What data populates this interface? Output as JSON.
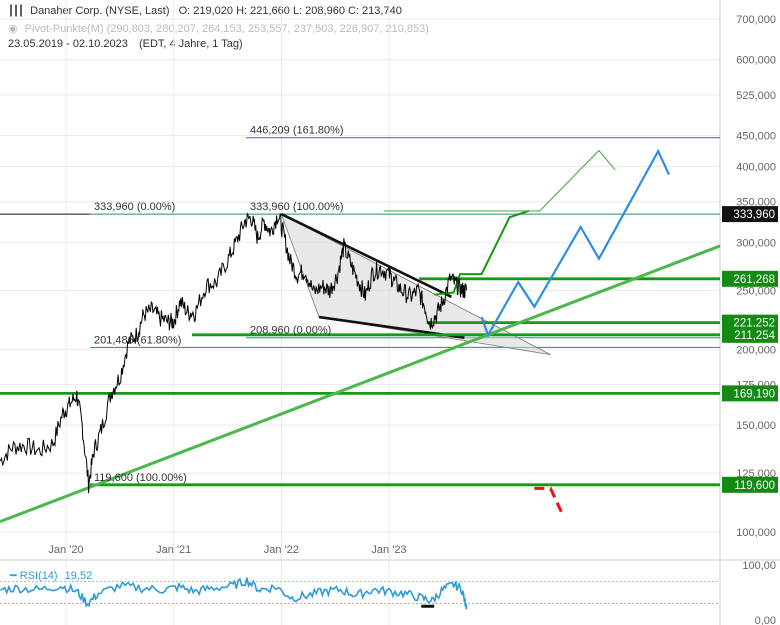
{
  "header": {
    "title": "Danaher Corp. (NYSE, Last)",
    "ohlc": "O: 219,020  H: 221,660  L: 208,960  C: 213,740",
    "pivot": "Pivot-Punkte(M)  (290,803,  280,207,  264,153,  253,557,  237,503,  226,907,  210,853)",
    "range": "23.05.2019 - 02.10.2023",
    "interval": "(EDT, 4 Jahre, 1 Tag)"
  },
  "rsi": {
    "label": "RSI(14)",
    "value": "19,52",
    "axis": [
      "100,00",
      "0,00"
    ]
  },
  "chart_data": {
    "type": "line",
    "title": "Danaher Corp. (NYSE, Last)",
    "yscale": "log",
    "ylim": [
      92,
      730
    ],
    "y_ticks": [
      {
        "v": 700,
        "label": "700,000"
      },
      {
        "v": 600,
        "label": "600,000"
      },
      {
        "v": 525,
        "label": "525,000"
      },
      {
        "v": 450,
        "label": "450,000"
      },
      {
        "v": 400,
        "label": "400,000"
      },
      {
        "v": 350,
        "label": "350,000"
      },
      {
        "v": 300,
        "label": "300,000"
      },
      {
        "v": 250,
        "label": "250,000"
      },
      {
        "v": 200,
        "label": "200,000"
      },
      {
        "v": 175,
        "label": "175,000"
      },
      {
        "v": 150,
        "label": "150,000"
      },
      {
        "v": 125,
        "label": "125,000"
      },
      {
        "v": 100,
        "label": "100,000"
      }
    ],
    "x_ticks": [
      {
        "t": 2020.0,
        "label": "Jan '20"
      },
      {
        "t": 2021.0,
        "label": "Jan '21"
      },
      {
        "t": 2022.0,
        "label": "Jan '22"
      },
      {
        "t": 2023.0,
        "label": "Jan '23"
      }
    ],
    "xlim": [
      2019.39,
      2024.8
    ],
    "series": [
      {
        "name": "Danaher Corp.",
        "points": [
          [
            2019.39,
            131
          ],
          [
            2019.5,
            138
          ],
          [
            2019.62,
            139
          ],
          [
            2019.75,
            136
          ],
          [
            2019.88,
            140
          ],
          [
            2019.97,
            157
          ],
          [
            2020.03,
            162
          ],
          [
            2020.1,
            168
          ],
          [
            2020.15,
            150
          ],
          [
            2020.21,
            120
          ],
          [
            2020.26,
            136
          ],
          [
            2020.33,
            148
          ],
          [
            2020.42,
            170
          ],
          [
            2020.5,
            180
          ],
          [
            2020.58,
            205
          ],
          [
            2020.66,
            212
          ],
          [
            2020.72,
            228
          ],
          [
            2020.8,
            232
          ],
          [
            2020.87,
            225
          ],
          [
            2020.95,
            222
          ],
          [
            2021.0,
            222
          ],
          [
            2021.06,
            240
          ],
          [
            2021.13,
            230
          ],
          [
            2021.2,
            230
          ],
          [
            2021.3,
            255
          ],
          [
            2021.4,
            258
          ],
          [
            2021.5,
            280
          ],
          [
            2021.58,
            300
          ],
          [
            2021.66,
            325
          ],
          [
            2021.72,
            330
          ],
          [
            2021.78,
            305
          ],
          [
            2021.84,
            325
          ],
          [
            2021.9,
            312
          ],
          [
            2021.97,
            334
          ],
          [
            2022.02,
            310
          ],
          [
            2022.08,
            280
          ],
          [
            2022.15,
            265
          ],
          [
            2022.22,
            270
          ],
          [
            2022.3,
            248
          ],
          [
            2022.38,
            254
          ],
          [
            2022.45,
            250
          ],
          [
            2022.52,
            265
          ],
          [
            2022.58,
            295
          ],
          [
            2022.65,
            275
          ],
          [
            2022.72,
            258
          ],
          [
            2022.78,
            245
          ],
          [
            2022.85,
            268
          ],
          [
            2022.92,
            272
          ],
          [
            2023.0,
            266
          ],
          [
            2023.05,
            258
          ],
          [
            2023.12,
            250
          ],
          [
            2023.2,
            244
          ],
          [
            2023.27,
            250
          ],
          [
            2023.33,
            236
          ],
          [
            2023.38,
            221
          ],
          [
            2023.44,
            228
          ],
          [
            2023.5,
            240
          ],
          [
            2023.57,
            262
          ],
          [
            2023.63,
            255
          ],
          [
            2023.68,
            250
          ],
          [
            2023.72,
            250
          ]
        ]
      }
    ],
    "rsi_series": [
      [
        2019.39,
        55
      ],
      [
        2019.55,
        58
      ],
      [
        2019.75,
        55
      ],
      [
        2019.95,
        62
      ],
      [
        2020.1,
        52
      ],
      [
        2020.2,
        30
      ],
      [
        2020.3,
        48
      ],
      [
        2020.5,
        62
      ],
      [
        2020.7,
        58
      ],
      [
        2020.9,
        55
      ],
      [
        2021.05,
        60
      ],
      [
        2021.2,
        52
      ],
      [
        2021.35,
        58
      ],
      [
        2021.55,
        62
      ],
      [
        2021.68,
        72
      ],
      [
        2021.8,
        55
      ],
      [
        2021.95,
        60
      ],
      [
        2022.1,
        40
      ],
      [
        2022.25,
        45
      ],
      [
        2022.4,
        52
      ],
      [
        2022.55,
        55
      ],
      [
        2022.7,
        45
      ],
      [
        2022.85,
        55
      ],
      [
        2023.0,
        52
      ],
      [
        2023.15,
        48
      ],
      [
        2023.3,
        40
      ],
      [
        2023.4,
        35
      ],
      [
        2023.5,
        55
      ],
      [
        2023.6,
        65
      ],
      [
        2023.68,
        55
      ],
      [
        2023.72,
        19.52
      ]
    ],
    "fib_levels": [
      {
        "value": 446.209,
        "label": "446,209 (161.80%)"
      },
      {
        "value": 333.96,
        "label": "333,960 (0.00%)"
      },
      {
        "value": 333.96,
        "label": "333,960 (100.00%)"
      },
      {
        "value": 208.96,
        "label": "208,960 (0.00%)"
      },
      {
        "value": 201.486,
        "label": "201,486 (61.80%)"
      },
      {
        "value": 119.6,
        "label": "119,600 (100.00%)"
      }
    ],
    "levels": [
      {
        "value": 333.96,
        "label": "333,960",
        "color": "#111111"
      },
      {
        "value": 261.268,
        "label": "261,268",
        "color": "#138a13"
      },
      {
        "value": 221.252,
        "label": "221,252",
        "color": "#138a13"
      },
      {
        "value": 211.254,
        "label": "211,254",
        "color": "#138a13"
      },
      {
        "value": 169.19,
        "label": "169,190",
        "color": "#138a13"
      },
      {
        "value": 119.6,
        "label": "119,600",
        "color": "#138a13"
      }
    ],
    "colors": {
      "price": "#000000",
      "support": "#139c13",
      "trend": "#4cb84c",
      "bull": "#3a9a3a",
      "blue": "#2c8ee6",
      "bear": "#ee1111",
      "rsi": "#2f9bd6",
      "fib161": "#5a4fcf"
    }
  }
}
